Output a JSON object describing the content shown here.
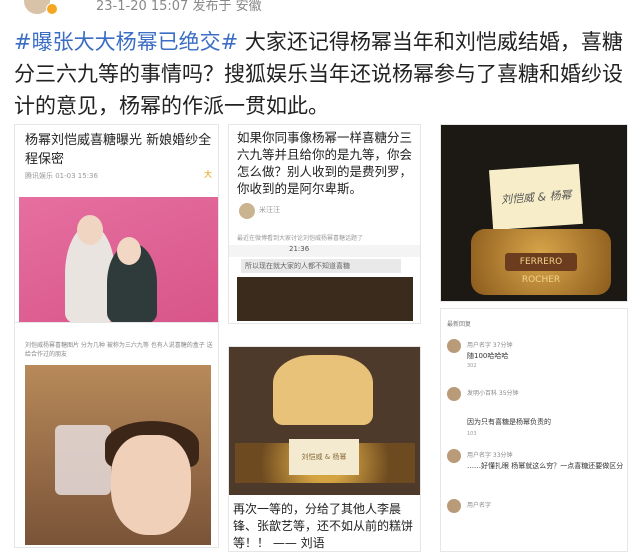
{
  "post": {
    "meta_text": "23-1-20 15:07 发布于 安徽",
    "hashtag": "#曝张大大杨幂已绝交#",
    "body": " 大家还记得杨幂当年和刘恺威结婚，喜糖分三六九等的事情吗？搜狐娱乐当年还说杨幂参与了喜糖和婚纱设计的意见，杨幂的作派一贯如此。"
  },
  "images": {
    "news": {
      "title": "杨幂刘恺威喜糖曝光 新娘婚纱全程保密",
      "source": "腾讯娱乐  01-03 15:36",
      "likes": "大"
    },
    "question": {
      "text": "如果你同事像杨幂一样喜糖分三六九等并且给你的是九等，你会怎么做？别人收到的是费列罗，你收到的是阿尔卑斯。",
      "user": "米汪汪",
      "small": "最近在微博看到大家讨论刘恺威杨幂喜糖话题了",
      "status_time": "21:36",
      "bubble": "所以现在就大家的人都不知道喜糖"
    },
    "gift": {
      "card_sig": "刘恺威 & 杨幂",
      "box_label": "FERRERO ROCHER"
    },
    "guy": {
      "caption_small": "刘恺威杨幂喜糖图片 分为几种 被称为三六九等 也有人说喜糖的盒子 送给合作过的朋友"
    },
    "chocolates": {
      "card_text": "刘恺威 & 杨幂",
      "caption": "再次一等的，分给了其他人李晨锋、张歆艺等，还不如从前的糕饼等！！ —— 刘语"
    },
    "comments": {
      "header": "最新回复",
      "items": [
        {
          "name": "用户名字 37分钟",
          "body": "随100哈哈哈",
          "likes": "302"
        },
        {
          "name": "发明小百科 35分钟",
          "body": "因为只有喜糖是杨幂负责的",
          "likes": "103"
        },
        {
          "name": "用户名字 33分钟",
          "body": "……好懂扎眼 杨幂就这么穷？一点喜糖还要做区分",
          "likes": ""
        },
        {
          "name": "用户名字",
          "body": "",
          "likes": ""
        }
      ]
    }
  }
}
